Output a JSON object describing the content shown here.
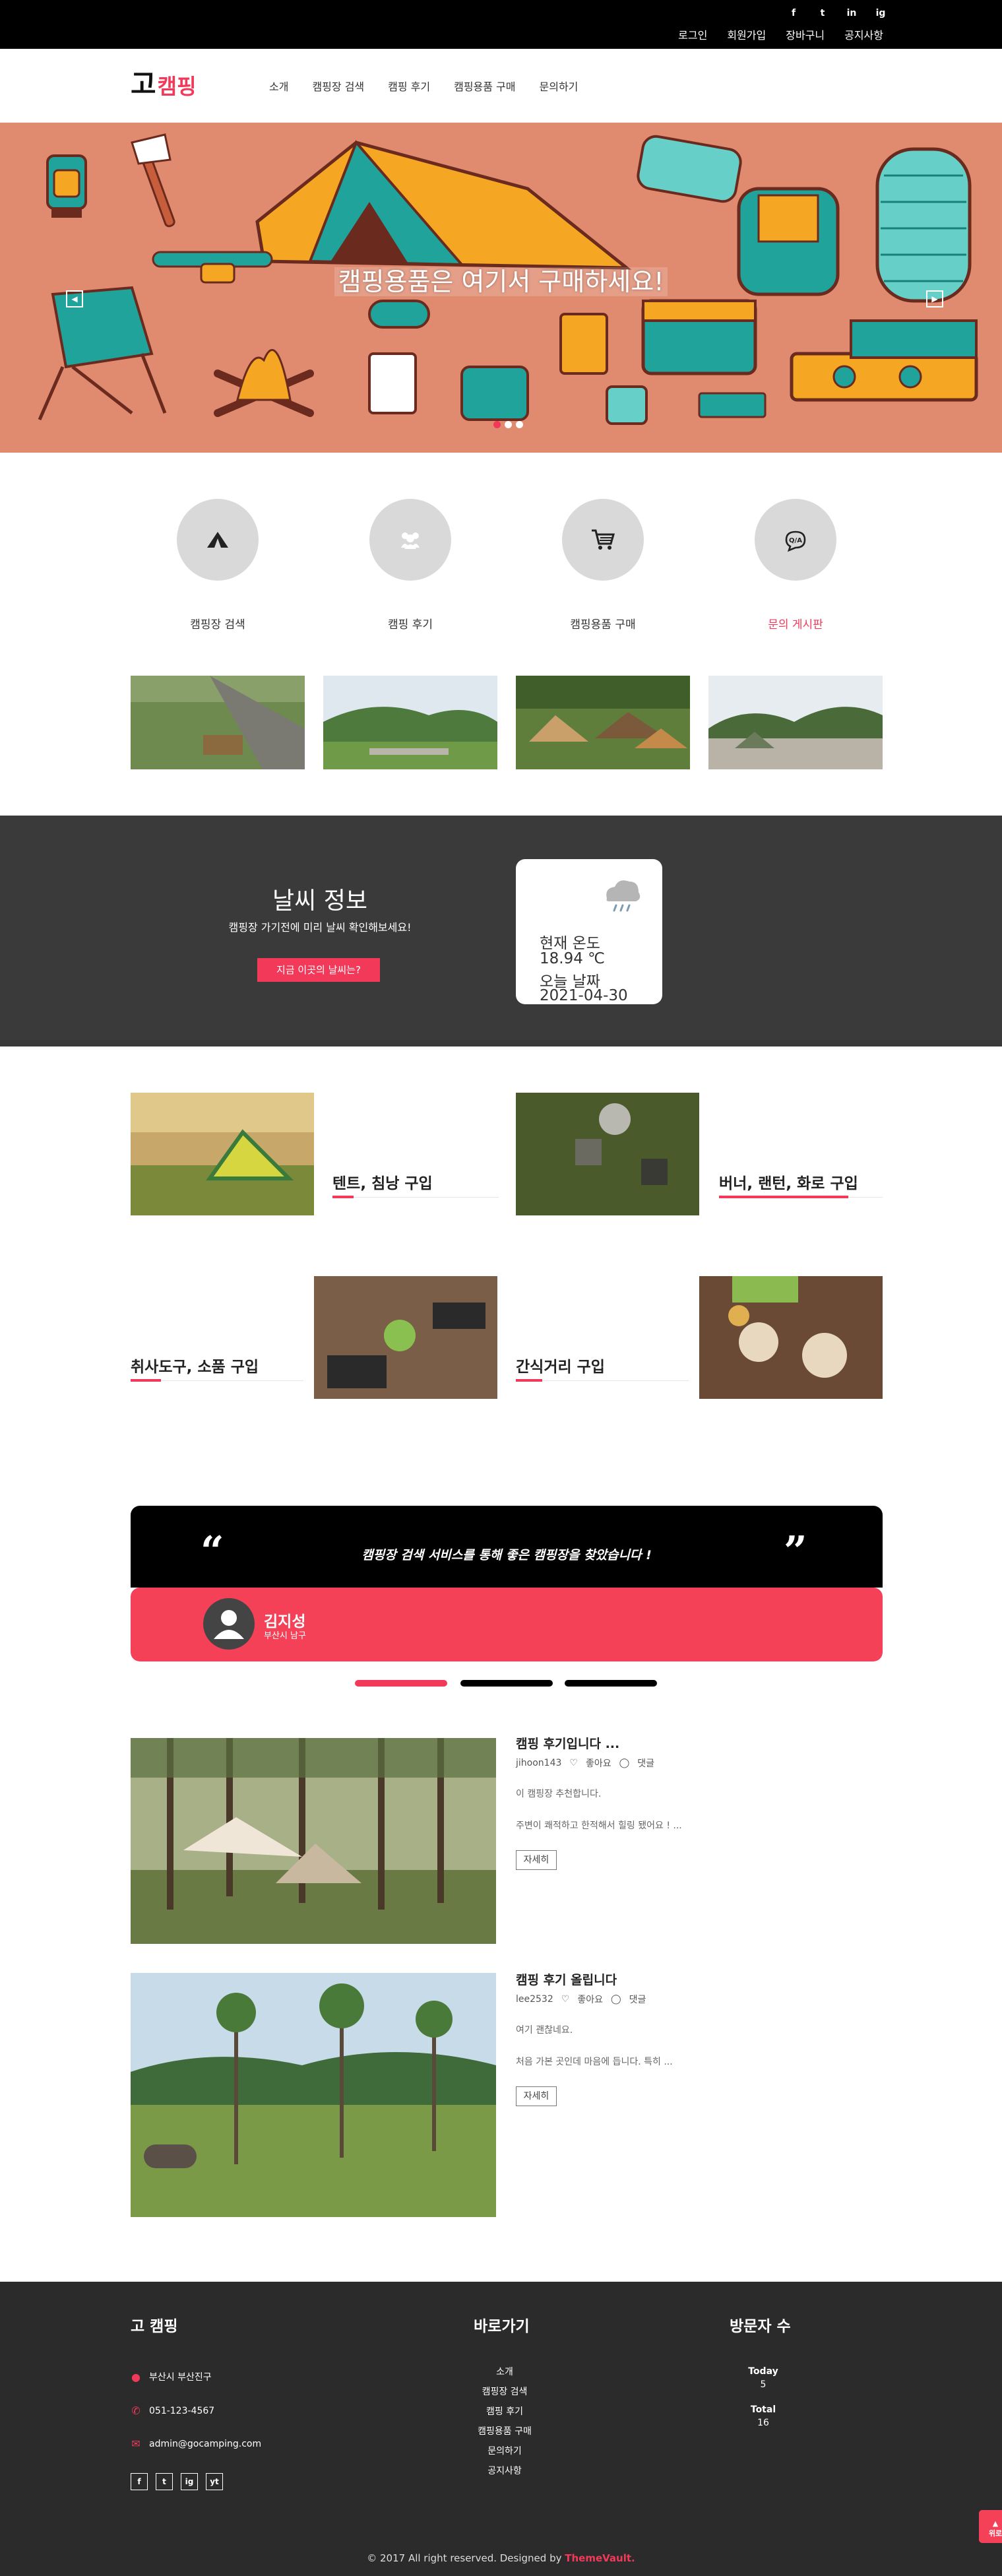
{
  "topbar": {
    "social": [
      "f",
      "t",
      "in",
      "ig"
    ],
    "links": [
      "로그인",
      "회원가입",
      "장바구니",
      "공지사항"
    ]
  },
  "header": {
    "logo_main": "고",
    "logo_sub": "캠핑",
    "nav": [
      "소개",
      "캠핑장 검색",
      "캠핑 후기",
      "캠핑용품 구매",
      "문의하기"
    ]
  },
  "hero": {
    "title": "캠핑용품은 여기서 구매하세요!",
    "slide_index": 1,
    "slide_count": 3
  },
  "services": [
    {
      "label": "캠핑장 검색",
      "icon": "tent-icon"
    },
    {
      "label": "캠핑 후기",
      "icon": "group-icon"
    },
    {
      "label": "캠핑용품 구매",
      "icon": "cart-icon"
    },
    {
      "label": "문의 게시판",
      "icon": "qa-chat-icon"
    }
  ],
  "weather": {
    "title": "날씨 정보",
    "subtitle": "캠핑장 가기전에 미리 날씨 확인해보세요!",
    "button": "지금 이곳의 날씨는?",
    "temp_label": "현재 온도",
    "temp_value": "18.94 ℃",
    "date_label": "오늘 날짜",
    "date_value": "2021-04-30",
    "icon": "rain-cloud-icon"
  },
  "categories": [
    {
      "title": "텐트, 침낭 구입"
    },
    {
      "title": "버너, 랜턴, 화로 구입"
    },
    {
      "title": "취사도구, 소품 구입"
    },
    {
      "title": "간식거리 구입"
    }
  ],
  "testimonial": {
    "quote": "캠핑장 검색 서비스를 통해 좋은 캠핑장을 찾았습니다 !",
    "name": "김지성",
    "location": "부산시 남구",
    "active_index": 1,
    "count": 3
  },
  "reviews": [
    {
      "title": "캠핑 후기입니다 ...",
      "author": "jihoon143",
      "like_label": "좋아요",
      "comment_label": "댓글",
      "line1": "이 캠핑장 추천합니다.",
      "line2": "주변이 쾌적하고 한적해서 힐링 됐어요 ! ...",
      "button": "자세히"
    },
    {
      "title": "캠핑 후기 올립니다",
      "author": "lee2532",
      "like_label": "좋아요",
      "comment_label": "댓글",
      "line1": "여기 괜찮네요.",
      "line2": "처음 가본 곳인데 마음에 듭니다. 특히 ...",
      "button": "자세히"
    }
  ],
  "footer": {
    "brand": "고 캠핑",
    "address": "부산시 부산진구",
    "phone": "051-123-4567",
    "email": "admin@gocamping.com",
    "social": [
      "f",
      "t",
      "ig",
      "yt"
    ],
    "shortcuts_title": "바로가기",
    "shortcuts": [
      "소개",
      "캠핑장 검색",
      "캠핑 후기",
      "캠핑용품 구매",
      "문의하기",
      "공지사항"
    ],
    "visitors_title": "방문자 수",
    "today_label": "Today",
    "today_value": "5",
    "total_label": "Total",
    "total_value": "16",
    "copyright": "© 2017 All right reserved. Designed by",
    "designer": "ThemeVault.",
    "top_button": "위로"
  },
  "colors": {
    "accent": "#f2395a",
    "topbar": "#000000",
    "weather_bg": "#3a3a3a",
    "footer_bg": "#2b2b2b",
    "hero_bg": "#e08a6f"
  }
}
